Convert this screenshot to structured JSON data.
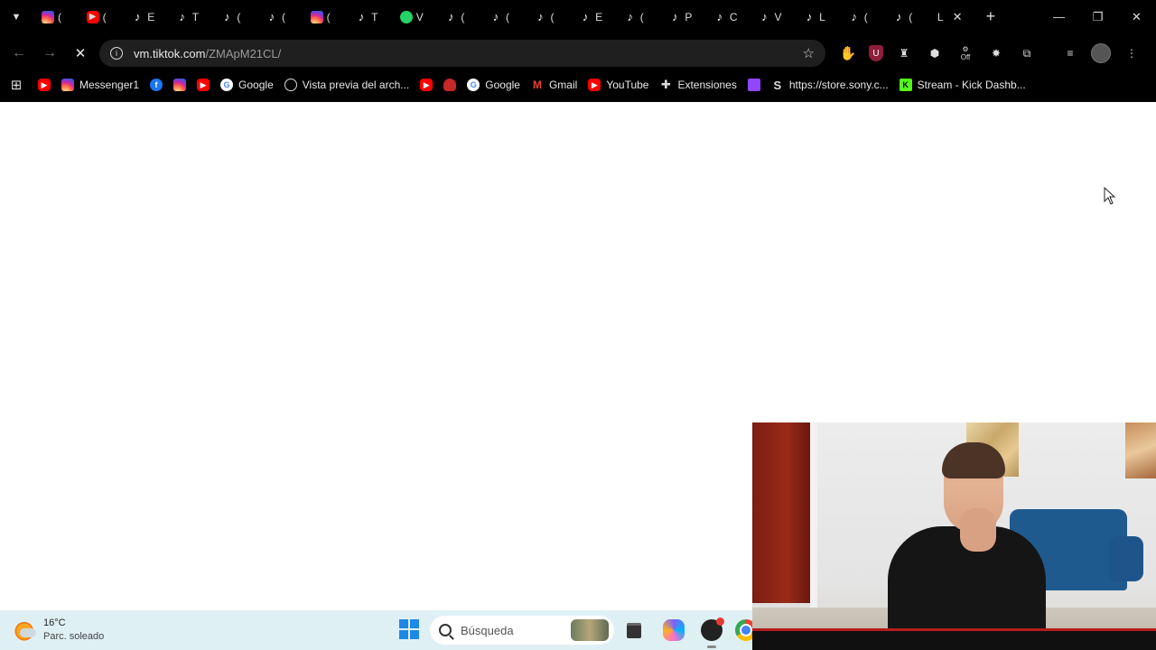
{
  "browser": {
    "tabs": [
      {
        "icon": "instagram",
        "letter": "("
      },
      {
        "icon": "youtube",
        "letter": "("
      },
      {
        "icon": "tiktok",
        "letter": "E"
      },
      {
        "icon": "tiktok",
        "letter": "T"
      },
      {
        "icon": "tiktok",
        "letter": "("
      },
      {
        "icon": "tiktok",
        "letter": "("
      },
      {
        "icon": "instagram",
        "letter": "("
      },
      {
        "icon": "tiktok",
        "letter": "T"
      },
      {
        "icon": "whatsapp",
        "letter": "V"
      },
      {
        "icon": "tiktok",
        "letter": "("
      },
      {
        "icon": "tiktok",
        "letter": "("
      },
      {
        "icon": "tiktok",
        "letter": "("
      },
      {
        "icon": "tiktok",
        "letter": "E"
      },
      {
        "icon": "tiktok",
        "letter": "("
      },
      {
        "icon": "tiktok",
        "letter": "P"
      },
      {
        "icon": "tiktok",
        "letter": "C"
      },
      {
        "icon": "tiktok",
        "letter": "V"
      },
      {
        "icon": "tiktok",
        "letter": "L"
      },
      {
        "icon": "tiktok",
        "letter": "("
      },
      {
        "icon": "tiktok",
        "letter": "("
      }
    ],
    "active_tab": {
      "letter": "L",
      "close": "✕"
    },
    "new_tab": "+",
    "window_controls": {
      "minimize": "—",
      "restore": "❐",
      "close": "✕"
    },
    "address": {
      "host": "vm.tiktok.com",
      "path": "/ZMApM21CL/"
    },
    "bookmarks": [
      {
        "icon": "youtube",
        "label": ""
      },
      {
        "icon": "instagram",
        "label": "Messenger1"
      },
      {
        "icon": "facebook",
        "label": ""
      },
      {
        "icon": "instagram",
        "label": ""
      },
      {
        "icon": "youtube",
        "label": ""
      },
      {
        "icon": "google",
        "label": "Google"
      },
      {
        "icon": "globe",
        "label": "Vista previa del arch..."
      },
      {
        "icon": "youtube",
        "label": ""
      },
      {
        "icon": "red-shield",
        "label": ""
      },
      {
        "icon": "google",
        "label": "Google"
      },
      {
        "icon": "gmail",
        "label": "Gmail"
      },
      {
        "icon": "youtube",
        "label": "YouTube"
      },
      {
        "icon": "extension",
        "label": "Extensiones"
      },
      {
        "icon": "twitch",
        "label": ""
      },
      {
        "icon": "store-s",
        "label": "https://store.sony.c..."
      },
      {
        "icon": "kick",
        "label": "Stream - Kick Dashb..."
      }
    ],
    "extension_off_label": "Off"
  },
  "taskbar": {
    "weather": {
      "temp": "16°C",
      "desc": "Parc. soleado"
    },
    "search_placeholder": "Búsqueda"
  }
}
